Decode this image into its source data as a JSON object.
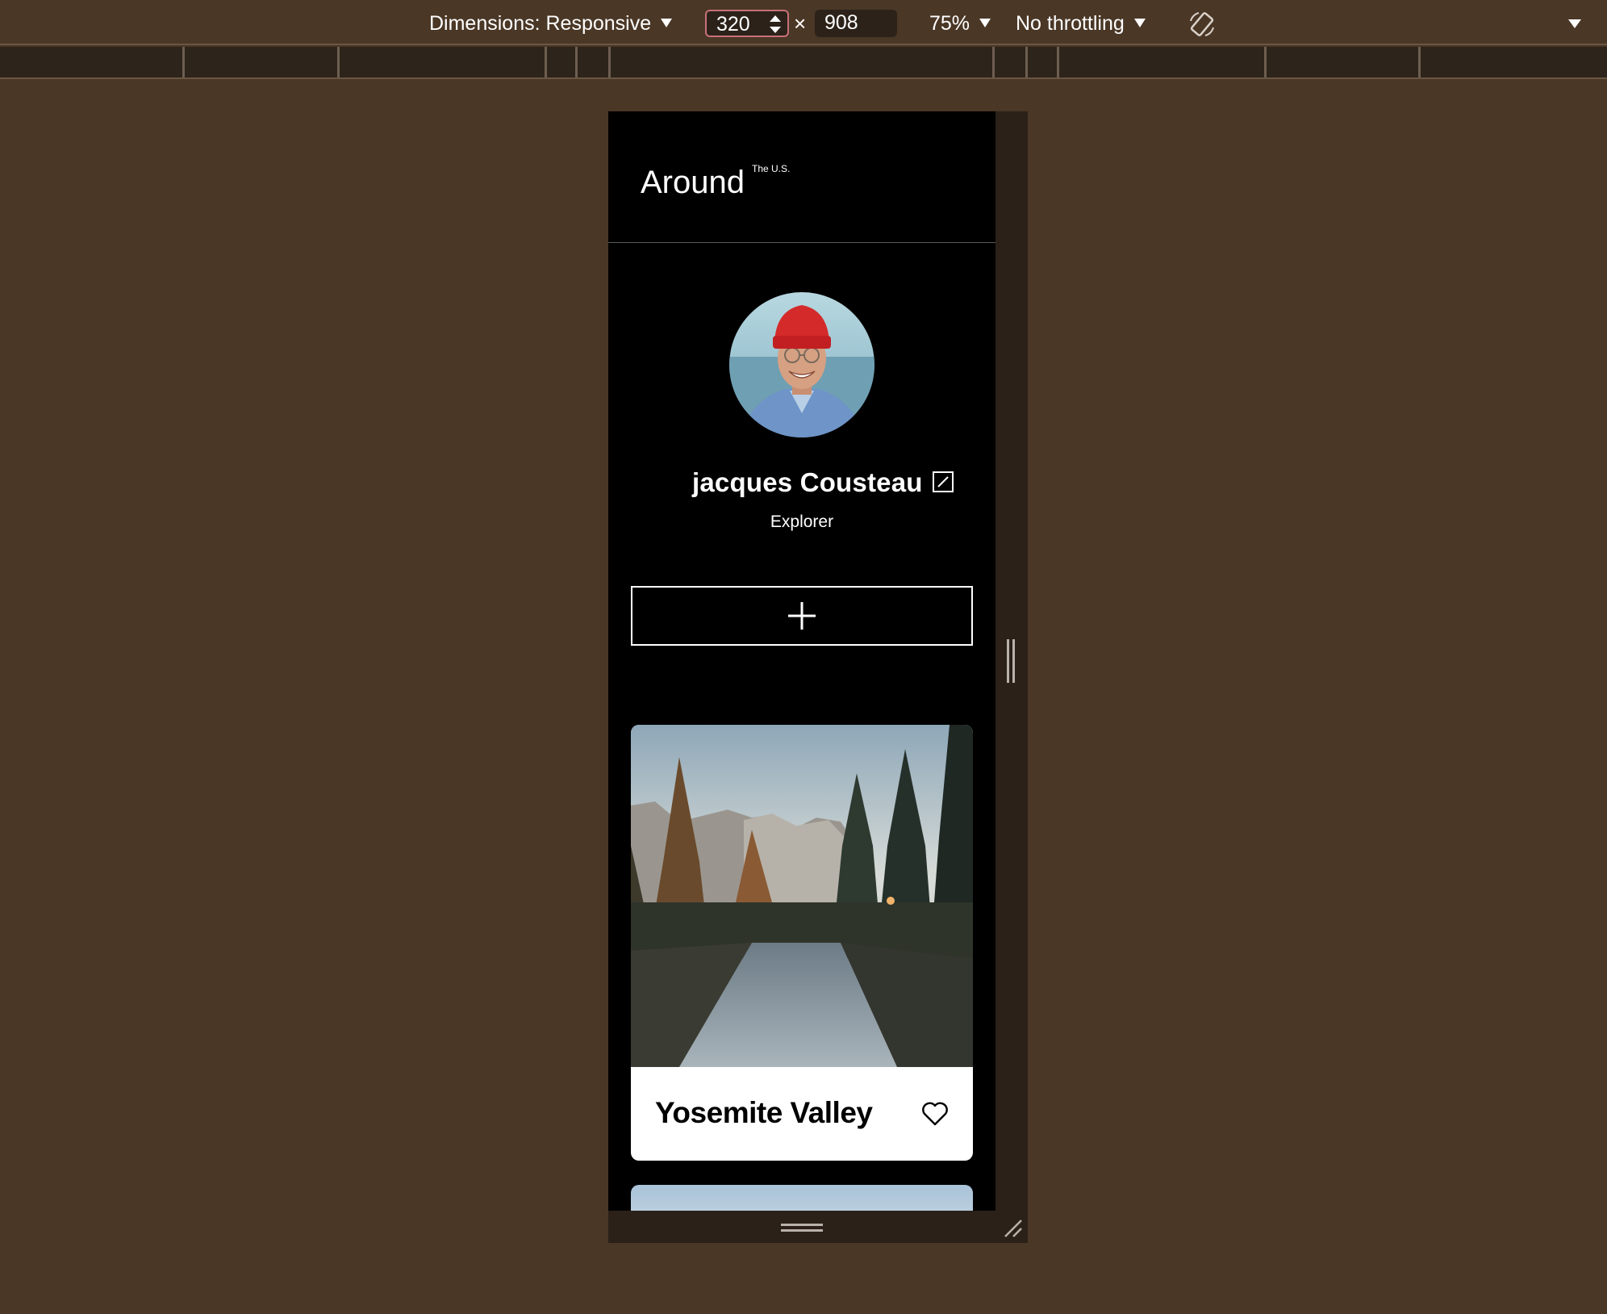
{
  "devtools": {
    "dimensions_label": "Dimensions: Responsive",
    "width_value": "320",
    "height_value": "908",
    "times_symbol": "×",
    "zoom": "75%",
    "throttling": "No throttling"
  },
  "page": {
    "logo": {
      "main": "Around",
      "superscript": "The U.S."
    },
    "profile": {
      "name": "jacques Cousteau",
      "role": "Explorer"
    },
    "cards": [
      {
        "title": "Yosemite Valley"
      }
    ]
  },
  "colors": {
    "devtools_bg": "#4a3726",
    "page_bg": "#000000",
    "card_bg": "#ffffff",
    "hat_red": "#d42a2a"
  },
  "icons": [
    "chevron-down-icon",
    "spinner-arrows-icon",
    "rotate-device-icon",
    "edit-icon",
    "plus-icon",
    "heart-icon",
    "resize-handle-icon"
  ]
}
